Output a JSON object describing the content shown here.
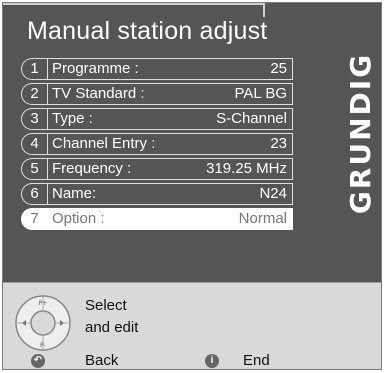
{
  "title": "Manual station adjust",
  "brand": "GRUNDIG",
  "menu": [
    {
      "num": "1",
      "label": "Programme :",
      "value": "25"
    },
    {
      "num": "2",
      "label": "TV Standard :",
      "value": "PAL BG"
    },
    {
      "num": "3",
      "label": "Type :",
      "value": "S-Channel"
    },
    {
      "num": "4",
      "label": "Channel Entry :",
      "value": "23"
    },
    {
      "num": "5",
      "label": "Frequency :",
      "value": "319.25 MHz"
    },
    {
      "num": "6",
      "label": "Name:",
      "value": "N24"
    },
    {
      "num": "7",
      "label": "Option :",
      "value": "Normal"
    }
  ],
  "footer": {
    "select_line1": "Select",
    "select_line2": "and edit",
    "back": "Back",
    "end": "End",
    "dpad_up": "P+",
    "dpad_down": "P-"
  },
  "colors": {
    "background": "#555555",
    "text": "#ffffff",
    "selected_bg": "#ffffff",
    "selected_text": "#777777",
    "footer_bg": "#d9d9d9"
  }
}
